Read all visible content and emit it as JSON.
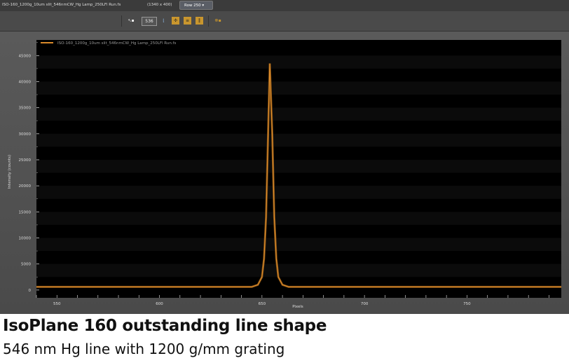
{
  "window": {
    "file_title": "ISO-160_1200g_10um slit_546nmCW_Hg Lamp_250LFl Run.fs",
    "dims": "(1340 x 400)",
    "row_tab": "Row 250 ▾",
    "toolbar": {
      "zoom_value": "536"
    }
  },
  "chart_data": {
    "type": "line",
    "title": "",
    "xlabel": "Pixels",
    "ylabel": "Intensity (counts)",
    "xlim": [
      540,
      796
    ],
    "ylim": [
      -1500,
      48000
    ],
    "xticks": [
      550,
      600,
      650,
      700,
      750
    ],
    "yticks": [
      0,
      5000,
      10000,
      15000,
      20000,
      25000,
      30000,
      35000,
      40000,
      45000
    ],
    "xtick_labels": [
      "550",
      "600",
      "650",
      "700",
      "750"
    ],
    "ytick_labels": [
      "0",
      "5000",
      "10000",
      "15000",
      "20000",
      "25000",
      "30000",
      "35000",
      "40000",
      "45000"
    ],
    "legend": {
      "position": "top-left",
      "entries": [
        "ISO-160_1200g_10um slit_546nmCW_Hg Lamp_250LFl Run.fs"
      ]
    },
    "grid": true,
    "series": [
      {
        "name": "ISO-160_1200g_10um slit_546nmCW_Hg Lamp_250LFl Run.fs",
        "color": "#d98a2b",
        "x": [
          540,
          645,
          648,
          650,
          651,
          652,
          653,
          653.8,
          655,
          656,
          657,
          658,
          660,
          663,
          796
        ],
        "y": [
          600,
          600,
          1000,
          2500,
          6000,
          14000,
          30000,
          43500,
          30000,
          14000,
          6000,
          2500,
          1000,
          600,
          600
        ]
      }
    ]
  },
  "caption": {
    "title": "IsoPlane 160 outstanding line shape",
    "subtitle": "546 nm Hg line with 1200 g/mm grating"
  }
}
